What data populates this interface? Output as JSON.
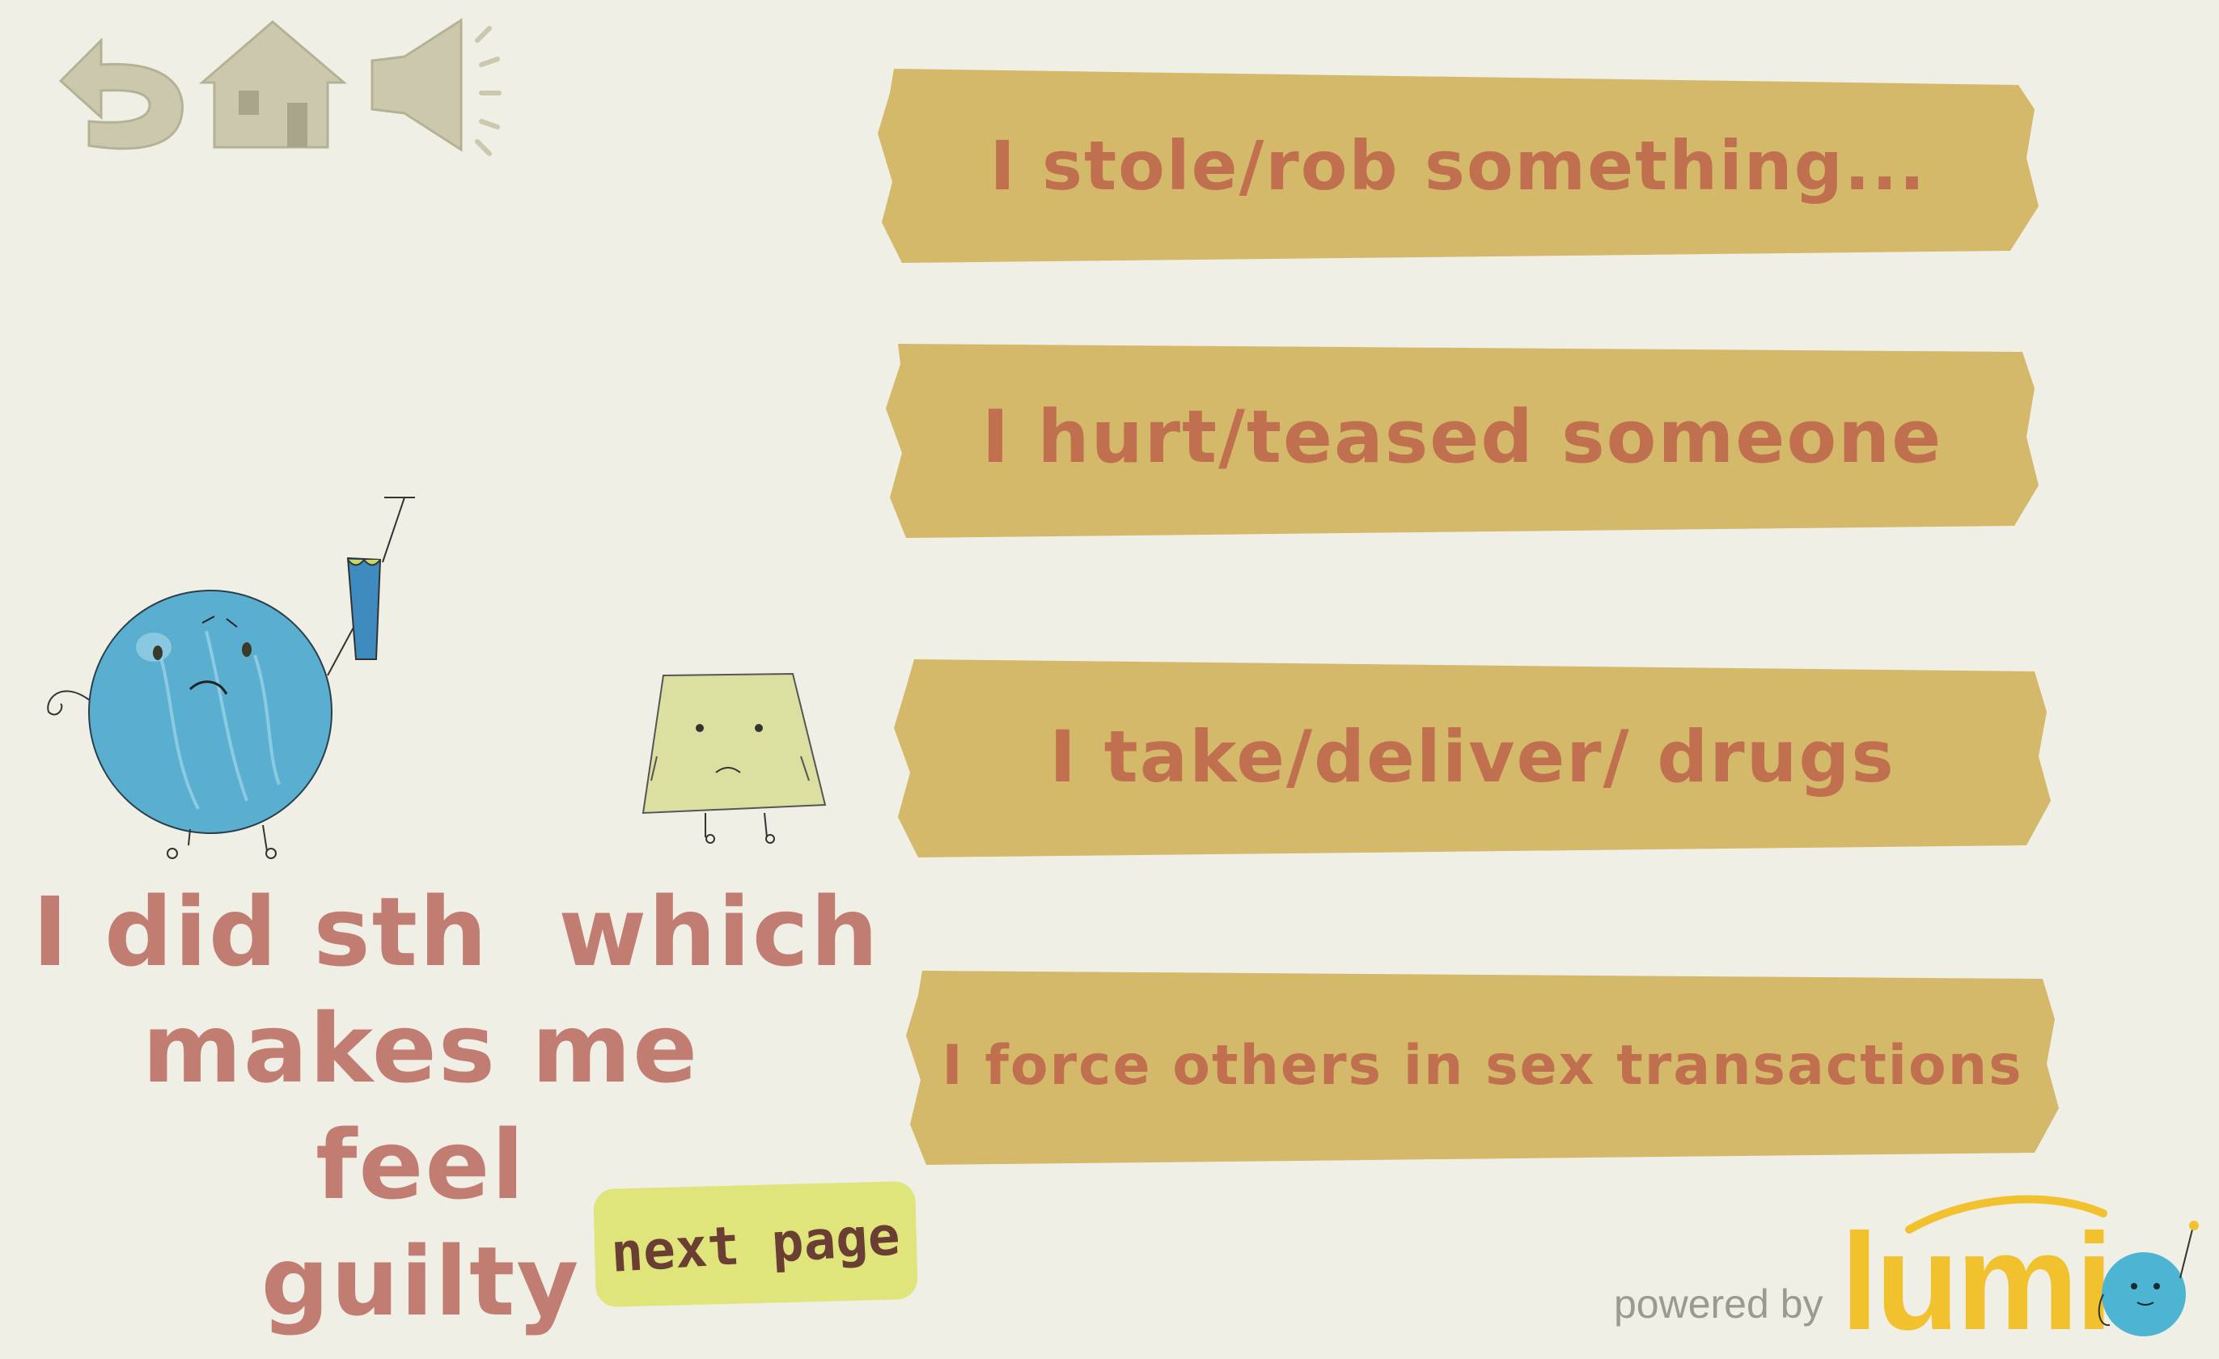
{
  "toolbar": {
    "back_icon": "undo-arrow-icon",
    "home_icon": "home-icon",
    "sound_icon": "speaker-icon",
    "icon_color": "#cbc8ad"
  },
  "options": [
    {
      "label": "I stole/rob something..."
    },
    {
      "label": "I hurt/teased someone"
    },
    {
      "label": "I take/deliver/ drugs"
    },
    {
      "label": "I force others in sex transactions"
    }
  ],
  "title": {
    "line1": "I did sth  which",
    "line2": "makes me feel",
    "line3": "guilty"
  },
  "next_button": {
    "label": "next page"
  },
  "branding": {
    "powered_by": "powered by",
    "brand_name": "lumi",
    "brand_color": "#f2c12e"
  },
  "colors": {
    "background": "#f0efe6",
    "option_fill": "#d4b96a",
    "option_text": "#c0704f",
    "title_text": "#c27d72",
    "next_button_fill": "#dfe57a"
  }
}
